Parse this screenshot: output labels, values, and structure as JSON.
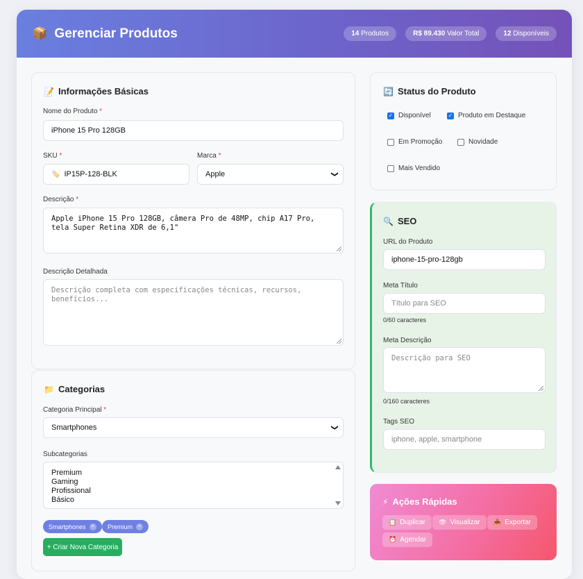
{
  "header": {
    "icon": "package-icon",
    "title": "Gerenciar Produtos",
    "stats": [
      {
        "value": "14",
        "label": "Produtos"
      },
      {
        "value": "R$ 89.430",
        "label": "Valor Total"
      },
      {
        "value": "12",
        "label": "Disponíveis"
      }
    ]
  },
  "basic": {
    "title": "Informações Básicas",
    "name_label": "Nome do Produto",
    "name_value": "iPhone 15 Pro 128GB",
    "sku_label": "SKU",
    "sku_value": "IP15P-128-BLK",
    "brand_label": "Marca",
    "brand_value": "Apple",
    "desc_label": "Descrição",
    "desc_value": "Apple iPhone 15 Pro 128GB, câmera Pro de 48MP, chip A17 Pro, tela Super Retina XDR de 6,1\"",
    "detail_label": "Descrição Detalhada",
    "detail_placeholder": "Descrição completa com especificações técnicas, recursos, benefícios...",
    "required_mark": "*"
  },
  "categories": {
    "title": "Categorias",
    "main_label": "Categoria Principal",
    "main_value": "Smartphones",
    "sub_label": "Subcategorias",
    "sub_options": [
      "Premium",
      "Gaming",
      "Profissional",
      "Básico"
    ],
    "tags": [
      "Smartphones",
      "Premium"
    ],
    "tag_remove": "×",
    "create_button": "+ Criar Nova Categoria"
  },
  "status": {
    "title": "Status do Produto",
    "options": [
      {
        "label": "Disponível",
        "checked": true
      },
      {
        "label": "Produto em Destaque",
        "checked": true
      },
      {
        "label": "Em Promoção",
        "checked": false
      },
      {
        "label": "Novidade",
        "checked": false
      },
      {
        "label": "Mais Vendido",
        "checked": false
      }
    ]
  },
  "seo": {
    "title": "SEO",
    "url_label": "URL do Produto",
    "url_value": "iphone-15-pro-128gb",
    "meta_title_label": "Meta Título",
    "meta_title_placeholder": "Título para SEO",
    "meta_title_count": "0/60 caracteres",
    "meta_desc_label": "Meta Descrição",
    "meta_desc_placeholder": "Descrição para SEO",
    "meta_desc_count": "0/160 caracteres",
    "tags_label": "Tags SEO",
    "tags_placeholder": "iphone, apple, smartphone"
  },
  "quick": {
    "title": "Ações Rápidas",
    "buttons": [
      {
        "label": "Duplicar",
        "icon": "clipboard-icon"
      },
      {
        "label": "Visualizar",
        "icon": "eye-icon"
      },
      {
        "label": "Exportar",
        "icon": "export-icon"
      },
      {
        "label": "Agendar",
        "icon": "clock-icon"
      }
    ]
  },
  "colors": {
    "header_start": "#6a7fe0",
    "header_end": "#7552b8",
    "accent_green": "#27ae60",
    "tag_blue": "#6e80e3"
  }
}
